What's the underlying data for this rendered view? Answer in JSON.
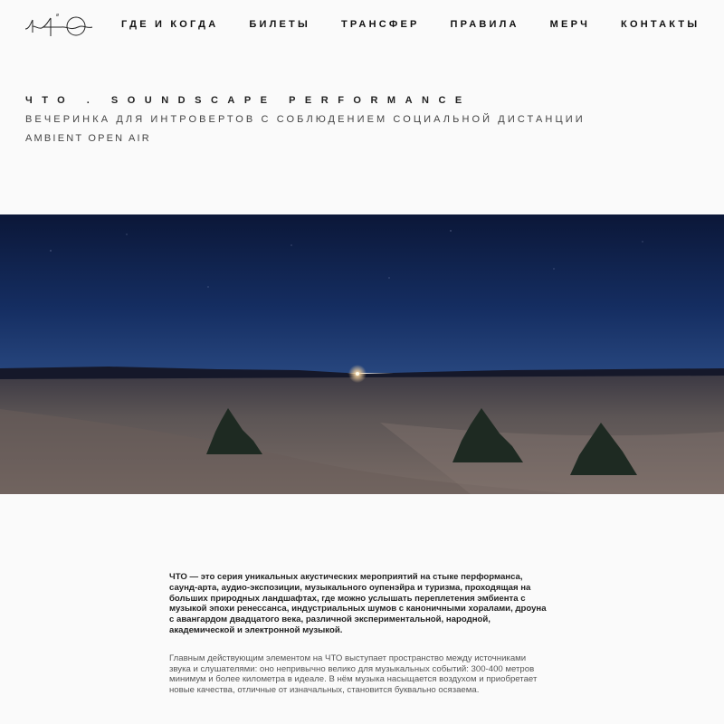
{
  "header": {
    "logo_name": "logo",
    "nav": [
      {
        "label": "ГДЕ И КОГДА"
      },
      {
        "label": "БИЛЕТЫ"
      },
      {
        "label": "ТРАНСФЕР"
      },
      {
        "label": "ПРАВИЛА"
      },
      {
        "label": "МЕРЧ"
      },
      {
        "label": "КОНТАКТЫ"
      }
    ]
  },
  "hero": {
    "title": "ЧТО . SOUNDSCAPE PERFORMANCE",
    "subtitle": "ВЕЧЕРИНКА ДЛЯ ИНТРОВЕРТОВ С СОБЛЮДЕНИЕМ СОЦИАЛЬНОЙ ДИСТАНЦИИ",
    "tagline": "AMBIENT OPEN AIR"
  },
  "content": {
    "lead": "ЧТО — это серия уникальных акустических мероприятий на стыке перформанса, саунд-арта, аудио-экспозиции, музыкального оупенэйра и туризма, проходящая на больших природных ландшафтах, где можно услышать переплетения эмбиента с музыкой эпохи ренессанса, индустриальных шумов с каноничными хоралами, дроуна с авангардом двадцатого века, различной экспериментальной, народной, академической и электронной музыкой.",
    "body": "Главным действующим элементом на ЧТО выступает пространство между источниками звука и слушателями: оно непривычно велико для музыкальных событий: 300-400 метров минимум и более километра в идеале. В нём музыка насыщается воздухом и приобретает новые качества, отличные от изначальных, становится буквально осязаема."
  },
  "colors": {
    "background": "#fafafa",
    "sky_top": "#0d1a3e",
    "sky_horizon": "#1d3f7a",
    "ground": "#6f6560"
  }
}
